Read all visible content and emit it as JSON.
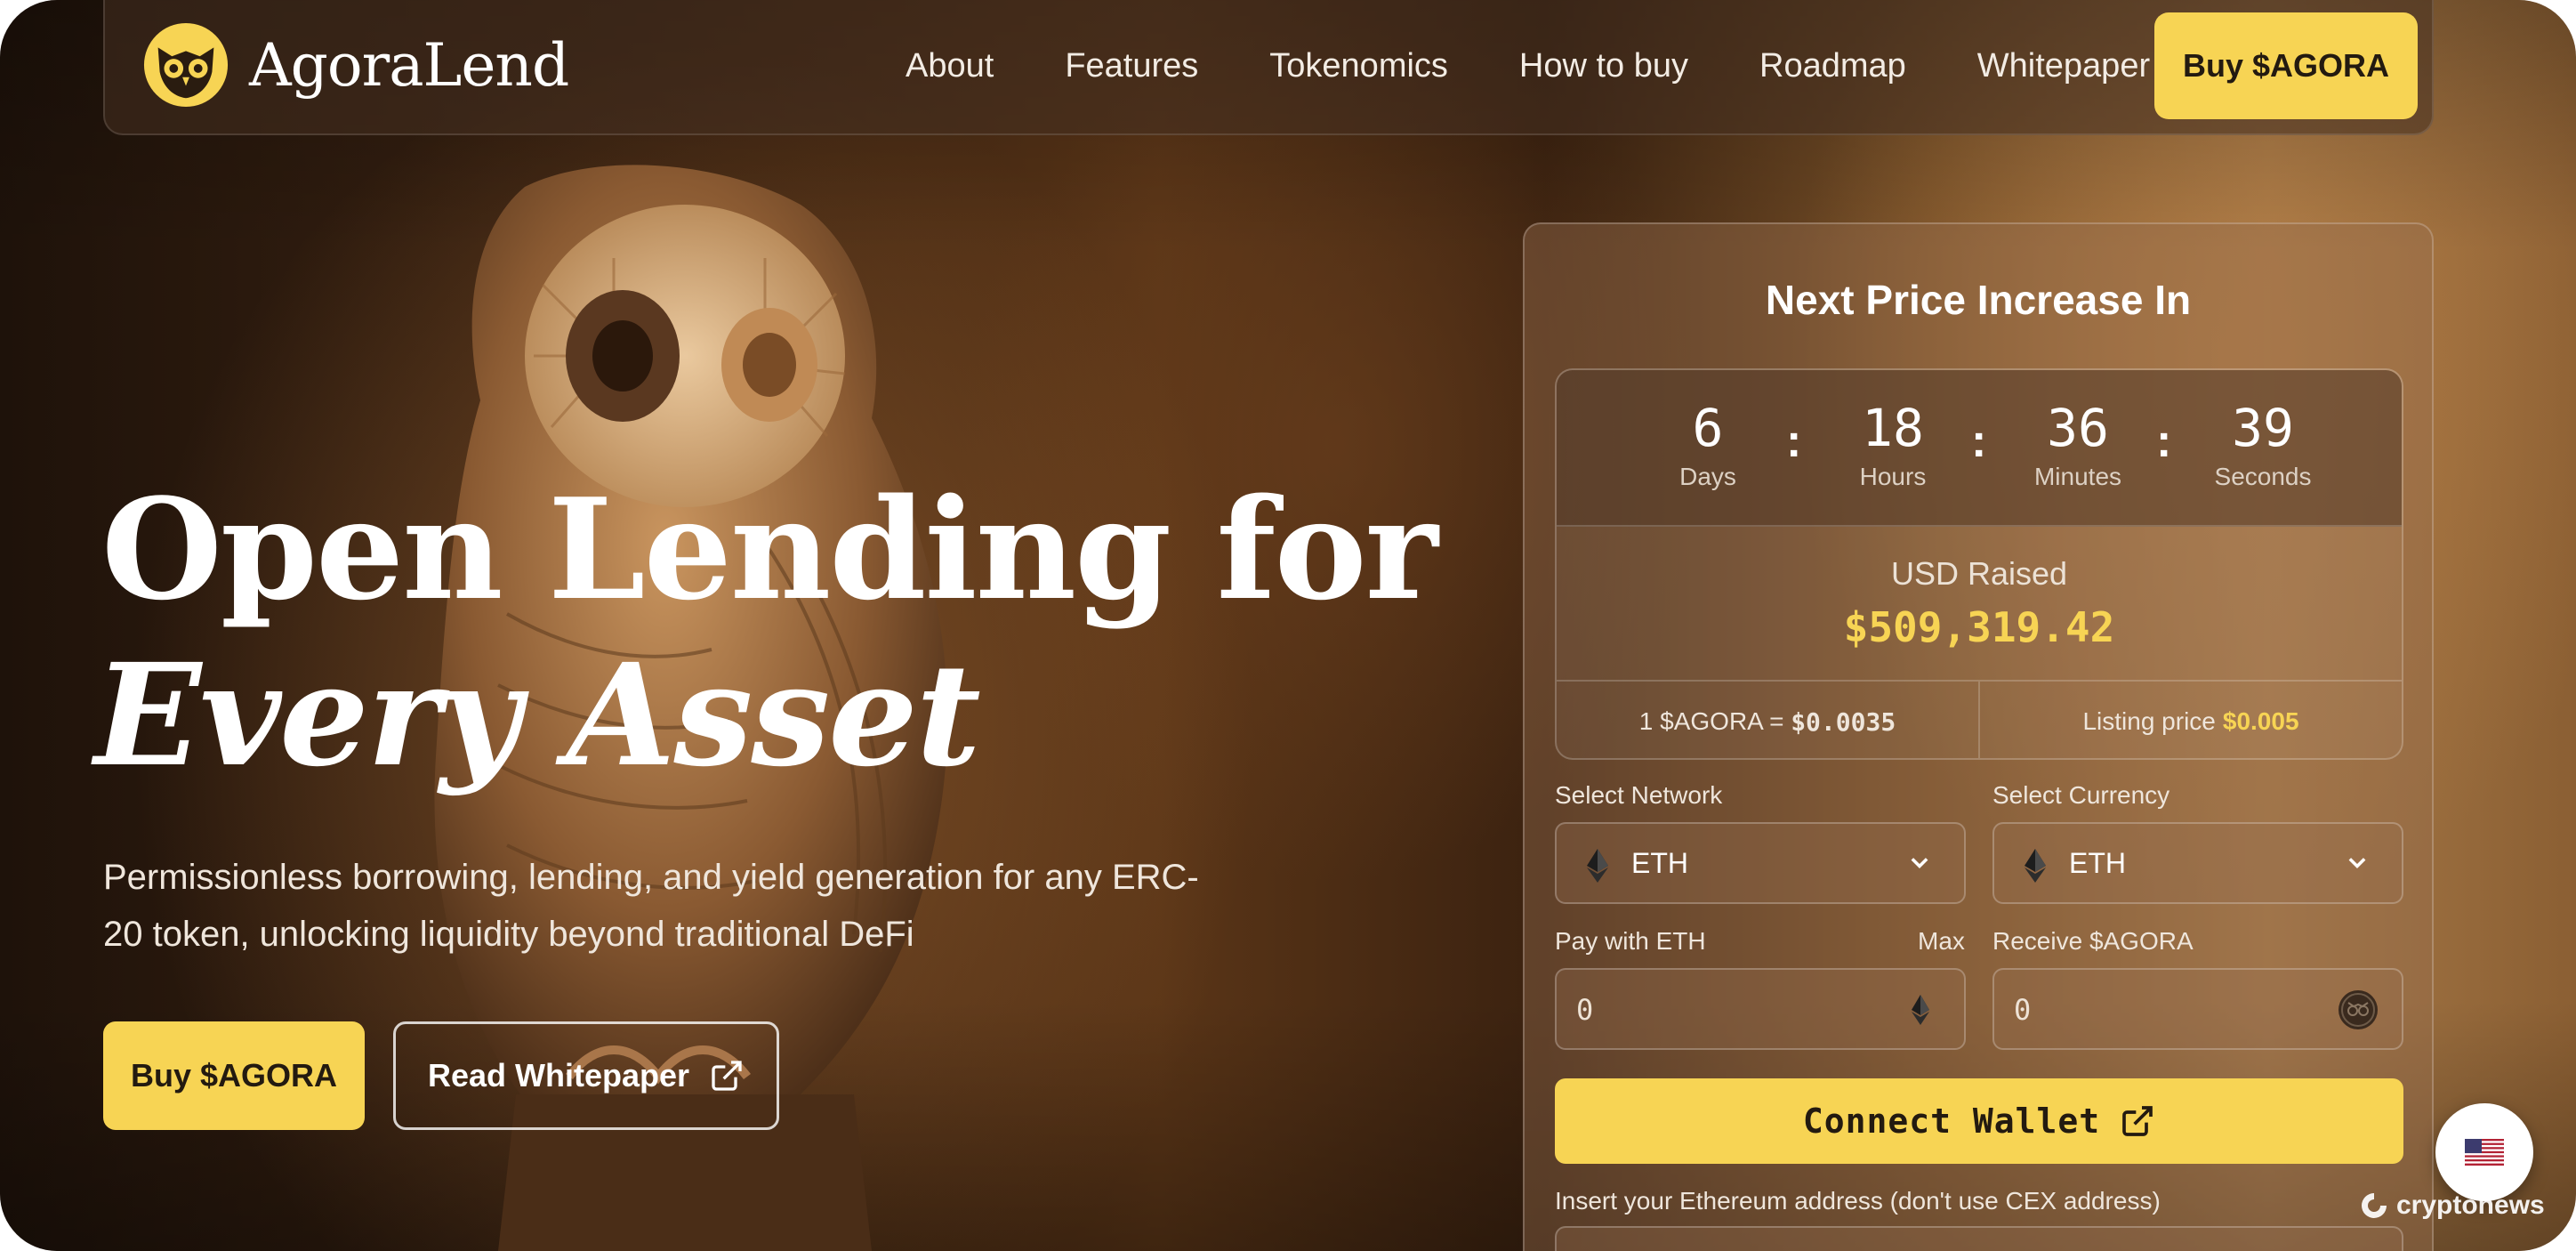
{
  "brand": {
    "name": "AgoraLend",
    "accent": "#f7d454",
    "logo_icon": "owl-icon"
  },
  "nav": {
    "links": [
      "About",
      "Features",
      "Tokenomics",
      "How to buy",
      "Roadmap",
      "Whitepaper"
    ],
    "cta": "Buy $AGORA"
  },
  "hero": {
    "title_line1": "Open Lending for",
    "title_line2": "Every Asset",
    "subtitle": "Permissionless borrowing, lending, and yield generation for any ERC-20 token, unlocking liquidity beyond traditional DeFi",
    "buy_button": "Buy $AGORA",
    "whitepaper_button": "Read Whitepaper",
    "whitepaper_icon": "external-link-icon"
  },
  "presale": {
    "title": "Next Price Increase In",
    "countdown": [
      {
        "value": "6",
        "label": "Days"
      },
      {
        "value": "18",
        "label": "Hours"
      },
      {
        "value": "36",
        "label": "Minutes"
      },
      {
        "value": "39",
        "label": "Seconds"
      }
    ],
    "separator": ":",
    "raised_label": "USD Raised",
    "raised_value": "$509,319.42",
    "rate_label": "1 $AGORA = ",
    "rate_value": "$0.0035",
    "listing_label": "Listing price",
    "listing_value": "$0.005",
    "network_label": "Select Network",
    "network_value": "ETH",
    "currency_label": "Select Currency",
    "currency_value": "ETH",
    "pay_label": "Pay with ETH",
    "max_label": "Max",
    "pay_value": "0",
    "receive_label": "Receive $AGORA",
    "receive_value": "0",
    "connect_button": "Connect Wallet",
    "address_label": "Insert your Ethereum address (don't use CEX address)"
  },
  "language": {
    "flag_icon": "us-flag-icon"
  },
  "watermark": {
    "text": "cryptonews"
  }
}
